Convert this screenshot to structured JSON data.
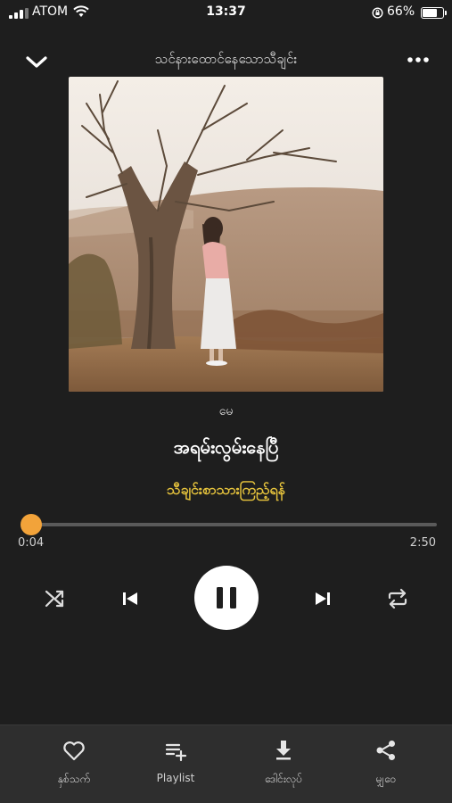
{
  "status_bar": {
    "carrier": "ATOM",
    "time": "13:37",
    "battery_percent": "66%",
    "battery_level": 0.66,
    "signal_bars_filled": 3,
    "icons": [
      "signal-icon",
      "wifi-icon",
      "rotation-lock-icon",
      "battery-icon"
    ]
  },
  "header": {
    "title": "သင်နားထောင်နေသောသီချင်း",
    "collapse_icon": "chevron-down-icon",
    "more_icon": "more-horizontal-icon"
  },
  "now_playing": {
    "album": "မေ",
    "title": "အရမ်းလွမ်းနေပြီ",
    "artist": "သီချင်းစာသားကြည့်ရန်",
    "elapsed": "0:04",
    "duration": "2:50",
    "progress_fraction": 0.024,
    "is_playing": true
  },
  "controls": {
    "shuffle_icon": "shuffle-icon",
    "prev_icon": "skip-previous-icon",
    "play_pause_icon": "pause-icon",
    "next_icon": "skip-next-icon",
    "repeat_icon": "repeat-icon"
  },
  "bottom_bar": {
    "items": [
      {
        "label": "နှစ်သက်",
        "icon": "heart-icon"
      },
      {
        "label": "Playlist",
        "icon": "playlist-add-icon"
      },
      {
        "label": "ဒေါင်းလုပ်",
        "icon": "download-icon"
      },
      {
        "label": "မျှဝေ",
        "icon": "share-icon"
      }
    ]
  },
  "colors": {
    "background": "#1e1e1e",
    "accent": "#f2a33a",
    "artist_text": "#e6c33c",
    "bottom_bar": "#2e2e2e"
  }
}
